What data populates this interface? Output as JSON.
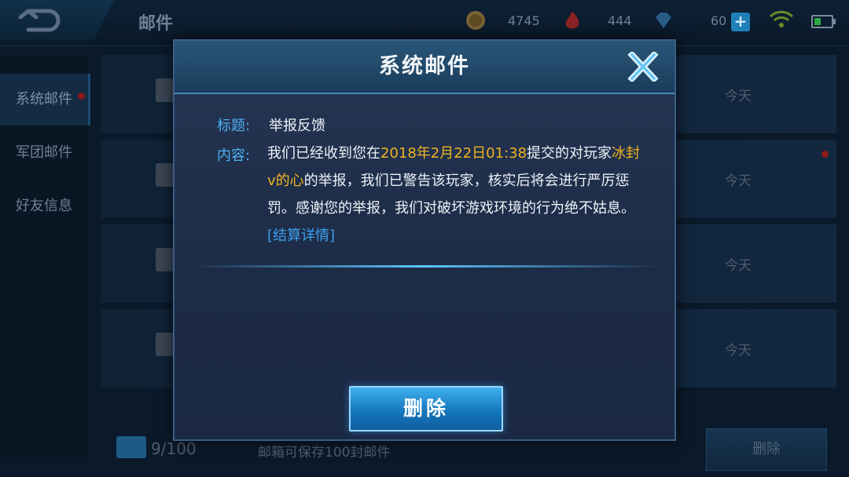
{
  "header": {
    "title": "邮件",
    "gold": "4745",
    "vouchers": "444",
    "diamonds": "60"
  },
  "sidebar": {
    "items": [
      {
        "label": "系统邮件"
      },
      {
        "label": "军团邮件"
      },
      {
        "label": "好友信息"
      }
    ]
  },
  "mail_list": {
    "rows": [
      {
        "date": "今天"
      },
      {
        "date": "今天"
      },
      {
        "date": "今天"
      },
      {
        "date": "今天"
      }
    ]
  },
  "footer": {
    "count": "9/100",
    "capacity_note": "邮箱可保存100封邮件",
    "delete_label": "删除"
  },
  "modal": {
    "title": "系统邮件",
    "subject_label": "标题:",
    "subject_value": "举报反馈",
    "content_label": "内容:",
    "content_part1": "我们已经收到您在",
    "content_time": "2018年2月22日01:38",
    "content_part2": "提交的对玩家",
    "content_player": "冰封v的心",
    "content_part3": "的举报，我们已警告该玩家，核实后将会进行严厉惩罚。感谢您的举报，我们对破坏游戏环境的行为绝不姑息。",
    "content_link": "[结算详情]",
    "delete_label": "删除"
  },
  "colors": {
    "highlight": "#f0b321",
    "link": "#3da0ec",
    "label": "#4fb2f0"
  }
}
